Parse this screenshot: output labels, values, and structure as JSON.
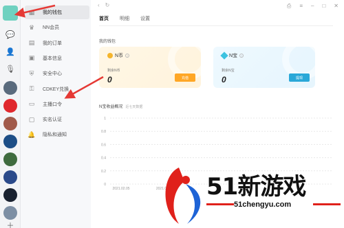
{
  "rail": {
    "items": [
      {
        "name": "chat-icon",
        "glyph": "💬"
      },
      {
        "name": "contacts-icon",
        "glyph": "👤"
      },
      {
        "name": "mic-icon",
        "glyph": "🎙"
      }
    ],
    "games": [
      {
        "name": "game-icon-1",
        "color": "#5a6b7d"
      },
      {
        "name": "game-icon-2",
        "color": "#e0282d"
      },
      {
        "name": "game-icon-3",
        "color": "#a15a4a"
      },
      {
        "name": "game-icon-4",
        "color": "#1d4e86"
      },
      {
        "name": "game-icon-5",
        "color": "#3f6b3e"
      },
      {
        "name": "game-icon-6",
        "color": "#2b4a8a"
      },
      {
        "name": "game-icon-7",
        "color": "#1a2230"
      },
      {
        "name": "game-icon-8",
        "color": "#7d8fa4"
      }
    ]
  },
  "sidebar": {
    "items": [
      {
        "label": "我的钱包",
        "icon": "wallet-icon",
        "glyph": "▦",
        "active": true
      },
      {
        "label": "NN会员",
        "icon": "vip-icon",
        "glyph": "♛",
        "active": false
      },
      {
        "label": "我的订单",
        "icon": "order-icon",
        "glyph": "▤",
        "active": false
      },
      {
        "label": "基本信息",
        "icon": "info-icon",
        "glyph": "▣",
        "active": false
      },
      {
        "label": "安全中心",
        "icon": "shield-icon",
        "glyph": "⛨",
        "active": false
      },
      {
        "label": "CDKEY兑换",
        "icon": "key-icon",
        "glyph": "⚿",
        "active": false
      },
      {
        "label": "主播口令",
        "icon": "anchor-icon",
        "glyph": "▭",
        "active": false
      },
      {
        "label": "实名认证",
        "icon": "id-icon",
        "glyph": "▢",
        "active": false
      },
      {
        "label": "隐私和通知",
        "icon": "bell-icon",
        "glyph": "🔔",
        "active": false
      }
    ]
  },
  "main": {
    "tabs": [
      {
        "label": "首页",
        "active": true
      },
      {
        "label": "明细",
        "active": false
      },
      {
        "label": "设置",
        "active": false
      }
    ],
    "wallet_title": "我的钱包",
    "cards": {
      "nn": {
        "title": "N币",
        "sub": "剩余N币",
        "value": "0",
        "button": "充值"
      },
      "nz": {
        "title": "N宝",
        "sub": "剩余N宝",
        "value": "0",
        "button": "提现"
      }
    },
    "chart_title": "N宝收益概况",
    "chart_subtitle": "近七天数据"
  },
  "chart_data": {
    "type": "line",
    "title": "N宝收益概况",
    "subtitle": "近七天数据",
    "x": [
      "2021.02.05",
      "2021.02.0"
    ],
    "yticks": [
      "1",
      "0.8",
      "0.6",
      "0.4",
      "0.2",
      "0"
    ],
    "ylim": [
      0,
      1
    ],
    "grid": true,
    "series": []
  },
  "watermark": {
    "text": "51新游戏",
    "url": "51chengyu.com"
  },
  "colors": {
    "accent_orange": "#ffa726",
    "accent_blue": "#2aa8d8",
    "arrow_red": "#e53935"
  }
}
